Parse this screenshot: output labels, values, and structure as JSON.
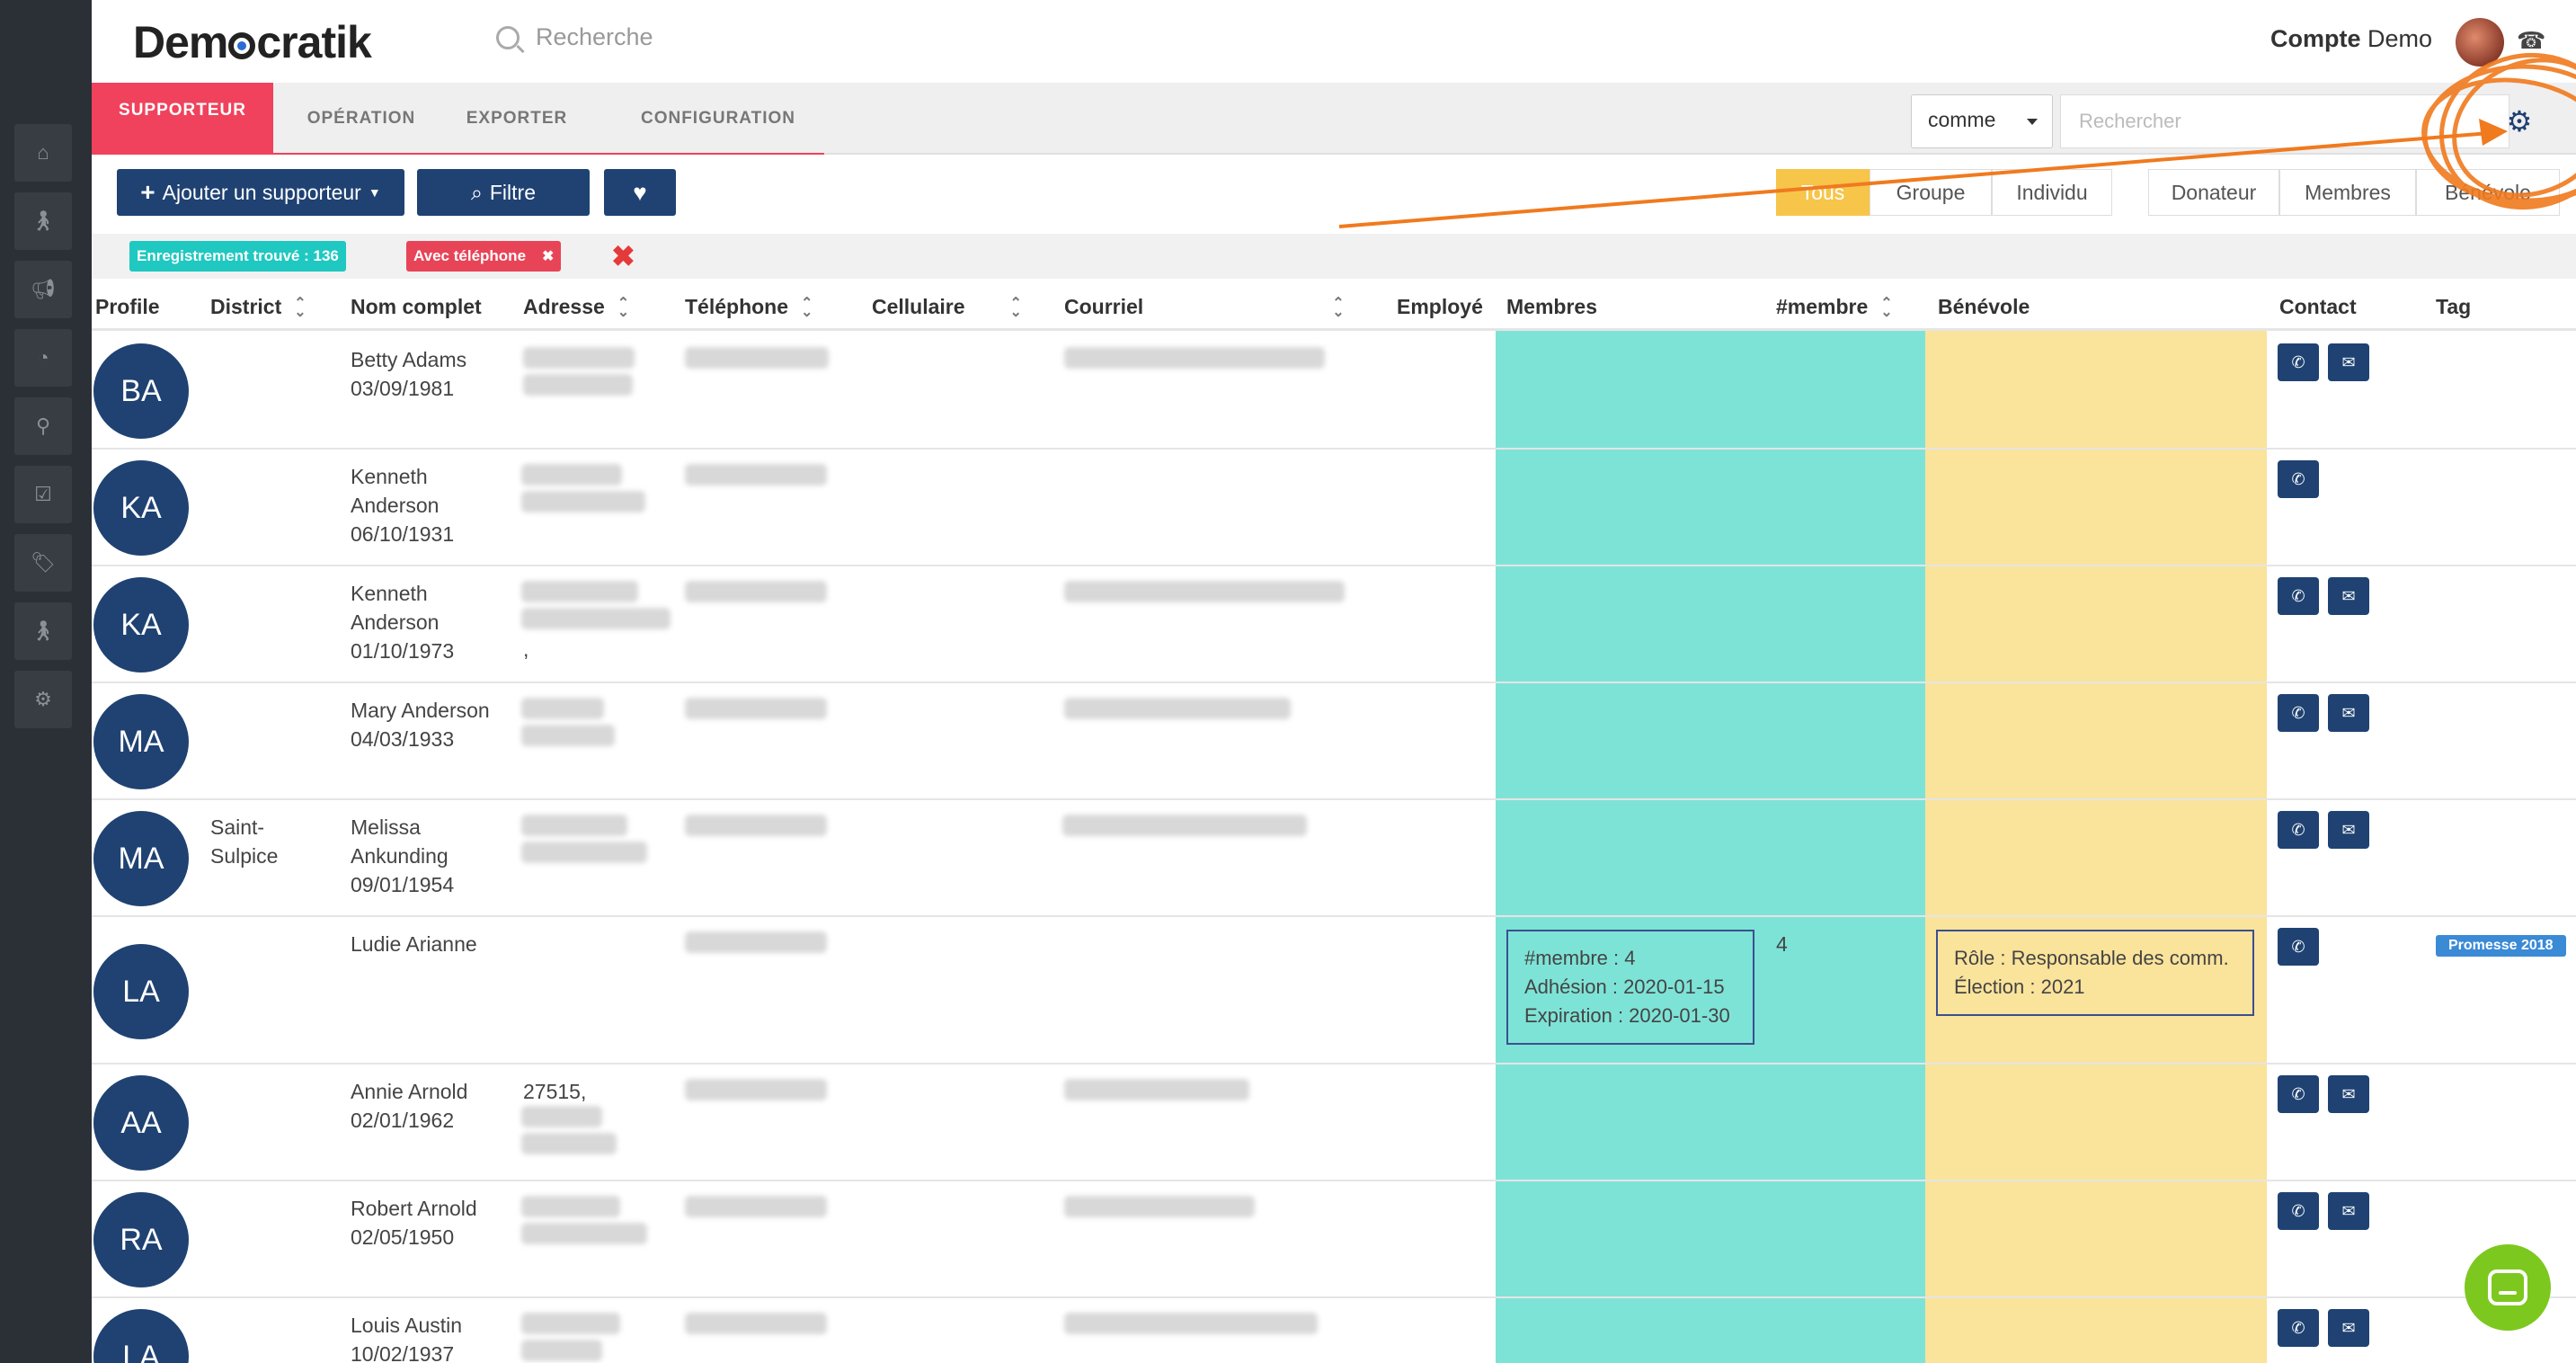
{
  "app": {
    "brand": "Democratik",
    "accent": "#f0425c",
    "navy": "#1f4272"
  },
  "header": {
    "search_placeholder": "Recherche",
    "account_bold": "Compte",
    "account_rest": " Demo"
  },
  "sidebar": {
    "icons": [
      "home-icon",
      "person-icon",
      "megaphone-icon",
      "pie-chart-icon",
      "map-pin-icon",
      "checkbox-icon",
      "tag-icon",
      "person-icon",
      "gear-icon"
    ]
  },
  "tabs": [
    {
      "label": "SUPPORTEUR",
      "active": true
    },
    {
      "label": "OPÉRATION",
      "active": false
    },
    {
      "label": "EXPORTER",
      "active": false
    },
    {
      "label": "CONFIGURATION",
      "active": false
    }
  ],
  "tabbar": {
    "select_value": "comme",
    "search_placeholder": "Rechercher"
  },
  "toolbar": {
    "add_label": "Ajouter un supporteur",
    "filter_label": "Filtre",
    "segments1": [
      "Tous",
      "Groupe",
      "Individu"
    ],
    "segments2": [
      "Donateur",
      "Membres",
      "Bénévole"
    ]
  },
  "filters": {
    "found": "Enregistrement trouvé : 136",
    "phone": "Avec téléphone"
  },
  "columns": [
    "Profile",
    "District",
    "Nom complet",
    "Adresse",
    "Téléphone",
    "Cellulaire",
    "Courriel",
    "Employé",
    "Membres",
    "#membre",
    "Bénévole",
    "Contact",
    "Tag"
  ],
  "rows": [
    {
      "initials": "BA",
      "district": "",
      "name": [
        "Betty Adams",
        "03/09/1981"
      ],
      "address": "",
      "membre": "",
      "tag": ""
    },
    {
      "initials": "KA",
      "district": "",
      "name": [
        "Kenneth",
        "Anderson",
        "06/10/1931"
      ],
      "address": "",
      "membre": "",
      "tag": ""
    },
    {
      "initials": "KA",
      "district": "",
      "name": [
        "Kenneth",
        "Anderson",
        "01/10/1973"
      ],
      "address": ",",
      "membre": "",
      "tag": ""
    },
    {
      "initials": "MA",
      "district": "",
      "name": [
        "Mary Anderson",
        "04/03/1933"
      ],
      "address": "",
      "membre": "",
      "tag": ""
    },
    {
      "initials": "MA",
      "district": "Saint-\nSulpice",
      "name": [
        "Melissa",
        "Ankunding",
        "09/01/1954"
      ],
      "address": "",
      "membre": "",
      "tag": ""
    },
    {
      "initials": "LA",
      "district": "",
      "name": [
        "Ludie Arianne"
      ],
      "address": "",
      "membre": "4",
      "tag": "Promesse 2018",
      "membres_box": [
        "#membre : 4",
        "Adhésion : 2020-01-15",
        "Expiration : 2020-01-30"
      ],
      "benevole_box": [
        "Rôle : Responsable des comm.",
        "Élection : 2021"
      ]
    },
    {
      "initials": "AA",
      "district": "",
      "name": [
        "Annie Arnold",
        "02/01/1962"
      ],
      "address": "27515,",
      "membre": "",
      "tag": ""
    },
    {
      "initials": "RA",
      "district": "",
      "name": [
        "Robert Arnold",
        "02/05/1950"
      ],
      "address": "",
      "membre": "",
      "tag": ""
    },
    {
      "initials": "LA",
      "district": "",
      "name": [
        "Louis Austin",
        "10/02/1937"
      ],
      "address": "",
      "membre": "",
      "tag": ""
    }
  ]
}
